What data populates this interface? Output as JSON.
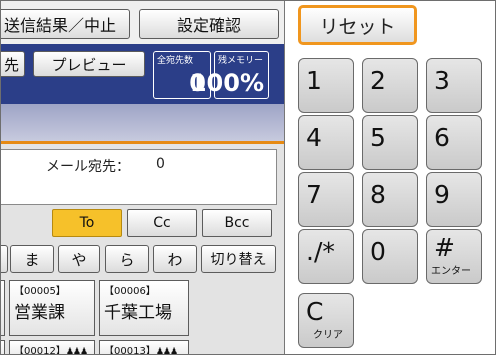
{
  "top_buttons": {
    "status": "送信結果／中止",
    "settings_check": "設定確認"
  },
  "toolbar": {
    "destination": "先",
    "preview": "プレビュー"
  },
  "counters": {
    "destinations": {
      "label": "全宛先数",
      "value": "0"
    },
    "memory": {
      "label": "残メモリー",
      "value": "100%"
    }
  },
  "mail": {
    "label": "メール宛先：",
    "count": "0"
  },
  "recipient_tabs": [
    "To",
    "Cc",
    "Bcc"
  ],
  "recipient_tab_active": "To",
  "index_keys": [
    "ま",
    "や",
    "ら",
    "わ"
  ],
  "switch_label": "切り替え",
  "entries": [
    {
      "number": "【00005】",
      "name": "営業課"
    },
    {
      "number": "【00006】",
      "name": "千葉工場"
    }
  ],
  "entries_row2": [
    {
      "number": "【00012】"
    },
    {
      "number": "【00013】"
    }
  ],
  "keypad": {
    "reset": "リセット",
    "keys": [
      "1",
      "2",
      "3",
      "4",
      "5",
      "6",
      "7",
      "8",
      "9",
      "./*",
      "0",
      "#"
    ],
    "enter_sub": "エンター",
    "clear": "C",
    "clear_sub": "クリア"
  },
  "colors": {
    "accent_orange": "#f0961e",
    "header_blue": "#2b3e88",
    "tab_active": "#f6c12a"
  }
}
